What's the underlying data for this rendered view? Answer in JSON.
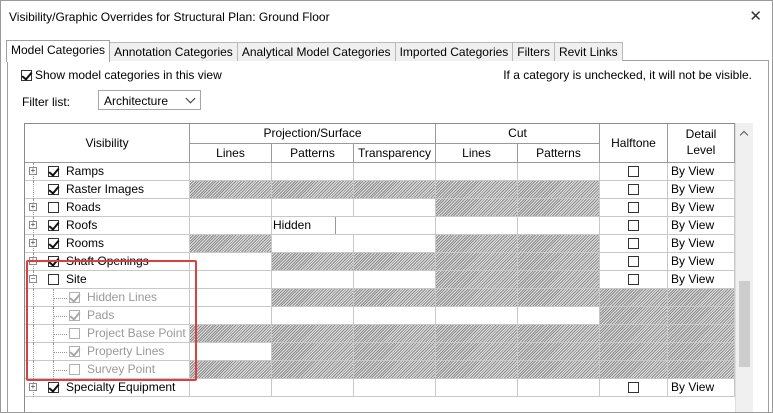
{
  "dialog": {
    "title": "Visibility/Graphic Overrides for Structural Plan: Ground Floor",
    "close_glyph": "✕"
  },
  "tabs": [
    "Model Categories",
    "Annotation Categories",
    "Analytical Model Categories",
    "Imported Categories",
    "Filters",
    "Revit Links"
  ],
  "options": {
    "show_model_categories": "Show model categories in this view",
    "show_model_categories_checked": true,
    "info": "If a category is unchecked, it will not be visible.",
    "filter_label": "Filter list:",
    "filter_value": "Architecture"
  },
  "columns": {
    "visibility": "Visibility",
    "projection_surface": "Projection/Surface",
    "cut": "Cut",
    "halftone": "Halftone",
    "detail_level": "Detail Level",
    "lines": "Lines",
    "patterns": "Patterns",
    "transparency": "Transparency",
    "cut_lines": "Lines",
    "cut_patterns": "Patterns"
  },
  "rows": [
    {
      "name": "Ramps",
      "checked": true,
      "expander": "+",
      "child": false,
      "grey": false,
      "detail": "By View",
      "halftone": true,
      "hatch": {
        "lines": false,
        "patterns": false,
        "transparency": false,
        "cut_lines": false,
        "cut_patterns": false
      }
    },
    {
      "name": "Raster Images",
      "checked": true,
      "expander": "",
      "child": false,
      "grey": false,
      "detail": "By View",
      "halftone": true,
      "hatch": {
        "lines": true,
        "patterns": true,
        "transparency": true,
        "cut_lines": true,
        "cut_patterns": true
      }
    },
    {
      "name": "Roads",
      "checked": false,
      "expander": "+",
      "child": false,
      "grey": false,
      "detail": "By View",
      "halftone": true,
      "hatch": {
        "lines": false,
        "patterns": false,
        "transparency": false,
        "cut_lines": true,
        "cut_patterns": true
      }
    },
    {
      "name": "Roofs",
      "checked": true,
      "expander": "+",
      "child": false,
      "grey": false,
      "detail": "By View",
      "halftone": true,
      "patterns_text": "Hidden",
      "hatch": {
        "lines": false,
        "patterns": false,
        "transparency": false,
        "cut_lines": false,
        "cut_patterns": false
      }
    },
    {
      "name": "Rooms",
      "checked": true,
      "expander": "+",
      "child": false,
      "grey": false,
      "detail": "By View",
      "halftone": true,
      "hatch": {
        "lines": true,
        "patterns": false,
        "transparency": false,
        "cut_lines": true,
        "cut_patterns": true
      }
    },
    {
      "name": "Shaft Openings",
      "checked": true,
      "expander": "+",
      "child": false,
      "grey": false,
      "detail": "By View",
      "halftone": true,
      "hatch": {
        "lines": false,
        "patterns": true,
        "transparency": true,
        "cut_lines": true,
        "cut_patterns": true
      }
    },
    {
      "name": "Site",
      "checked": false,
      "expander": "−",
      "child": false,
      "grey": false,
      "detail": "By View",
      "halftone": true,
      "hatch": {
        "lines": false,
        "patterns": false,
        "transparency": false,
        "cut_lines": true,
        "cut_patterns": true
      }
    },
    {
      "name": "Hidden Lines",
      "checked": true,
      "expander": "",
      "child": true,
      "grey": true,
      "detail": "",
      "halftone": false,
      "hatch": {
        "lines": false,
        "patterns": true,
        "transparency": true,
        "cut_lines": true,
        "cut_patterns": true
      }
    },
    {
      "name": "Pads",
      "checked": true,
      "expander": "",
      "child": true,
      "grey": true,
      "detail": "",
      "halftone": false,
      "hatch": {
        "lines": false,
        "patterns": false,
        "transparency": false,
        "cut_lines": false,
        "cut_patterns": false
      }
    },
    {
      "name": "Project Base Point",
      "checked": false,
      "expander": "",
      "child": true,
      "grey": true,
      "detail": "",
      "halftone": false,
      "hatch": {
        "lines": true,
        "patterns": true,
        "transparency": true,
        "cut_lines": true,
        "cut_patterns": true
      }
    },
    {
      "name": "Property Lines",
      "checked": true,
      "expander": "",
      "child": true,
      "grey": true,
      "detail": "",
      "halftone": false,
      "hatch": {
        "lines": false,
        "patterns": true,
        "transparency": true,
        "cut_lines": true,
        "cut_patterns": true
      }
    },
    {
      "name": "Survey Point",
      "checked": false,
      "expander": "",
      "child": true,
      "grey": true,
      "detail": "",
      "halftone": false,
      "hatch": {
        "lines": true,
        "patterns": true,
        "transparency": true,
        "cut_lines": true,
        "cut_patterns": true
      }
    },
    {
      "name": "Specialty Equipment",
      "checked": true,
      "expander": "+",
      "child": false,
      "grey": false,
      "detail": "By View",
      "halftone": true,
      "hatch": {
        "lines": false,
        "patterns": false,
        "transparency": false,
        "cut_lines": false,
        "cut_patterns": false
      }
    }
  ],
  "highlight_color": "#d94040"
}
